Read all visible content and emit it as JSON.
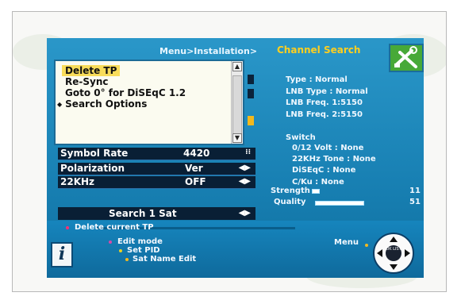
{
  "header": {
    "breadcrumb": "Menu>Installation>",
    "title": "Channel Search"
  },
  "menu": {
    "items": [
      {
        "label": "Delete TP",
        "highlighted": true,
        "has_bullet": false
      },
      {
        "label": "Re-Sync",
        "highlighted": false,
        "has_bullet": false
      },
      {
        "label": "Goto 0° for DiSEqC 1.2",
        "highlighted": false,
        "has_bullet": false
      },
      {
        "label": "Search Options",
        "highlighted": false,
        "has_bullet": true
      }
    ],
    "bullet": "◆"
  },
  "settings": [
    {
      "label": "Symbol Rate",
      "value": "4420",
      "control": "keypad"
    },
    {
      "label": "Polarization",
      "value": "Ver",
      "control": "◀▶"
    },
    {
      "label": "22KHz",
      "value": "OFF",
      "control": "◀▶"
    }
  ],
  "search_button": {
    "label": "Search 1 Sat",
    "control": "◀▶"
  },
  "info": {
    "type": "Type : Normal",
    "lnb_type": "LNB Type : Normal",
    "lnb_freq1": "LNB Freq. 1:5150",
    "lnb_freq2": "LNB Freq. 2:5150",
    "switch_title": "Switch",
    "volt": "0/12 Volt : None",
    "tone": "22KHz Tone : None",
    "diseqc": "DiSEqC : None",
    "cku": "C/Ku : None",
    "strength_label": "Strength",
    "strength_value": "11",
    "quality_label": "Quality",
    "quality_value": "51",
    "strength_level": 0.11,
    "quality_level": 0.51
  },
  "help": {
    "description": "Delete current TP",
    "line1": "Edit mode",
    "line2": "Set PID",
    "line3": "Sat Name Edit",
    "menu_label": "Menu",
    "pad_center": "OK LIST"
  },
  "colors": {
    "panel": "#1a88bd",
    "title": "#ffcf1f",
    "highlight": "#f8dc5a",
    "dark_row": "#091f35",
    "bullet_dot": "#ff2f73",
    "logo": "#47a938"
  },
  "icons": [
    "keypad-icon",
    "left-right-arrows-icon",
    "tools-icon",
    "info-icon",
    "navigation-pad-icon"
  ]
}
